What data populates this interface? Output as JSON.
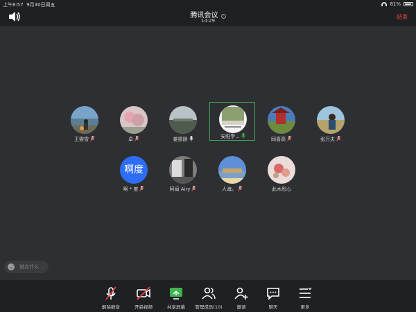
{
  "status": {
    "time": "上午8:57",
    "date": "9月30日周五",
    "battery": "81%"
  },
  "header": {
    "title": "腾讯会议",
    "duration": "14:29",
    "end_label": "结束"
  },
  "participants": [
    {
      "name": "王雯雪",
      "mic": "muted"
    },
    {
      "name": "卓",
      "mic": "muted"
    },
    {
      "name": "姜德刚",
      "mic": "on"
    },
    {
      "name": "安阳学...",
      "mic": "speaking",
      "active": true
    },
    {
      "name": "同喜高",
      "mic": "muted"
    },
    {
      "name": "张万夫",
      "mic": "muted"
    },
    {
      "name": "啊 * 度",
      "mic": "muted",
      "avatar_text": "啊度"
    },
    {
      "name": "阿闻 Airy",
      "mic": "muted"
    },
    {
      "name": "人海。",
      "mic": "muted"
    },
    {
      "name": "此木彤心",
      "mic": "none"
    }
  ],
  "chat": {
    "placeholder": "说点什么..."
  },
  "toolbar": {
    "unmute": "解除静音",
    "video": "开启视频",
    "share": "共享屏幕",
    "members": "管理成员(10)",
    "invite": "邀请",
    "chat": "聊天",
    "more": "更多"
  },
  "colors": {
    "end": "#e8463e",
    "active_border": "#3fa45a",
    "mic_green": "#3fb34f",
    "avatar_blue": "#2e6ef6"
  }
}
